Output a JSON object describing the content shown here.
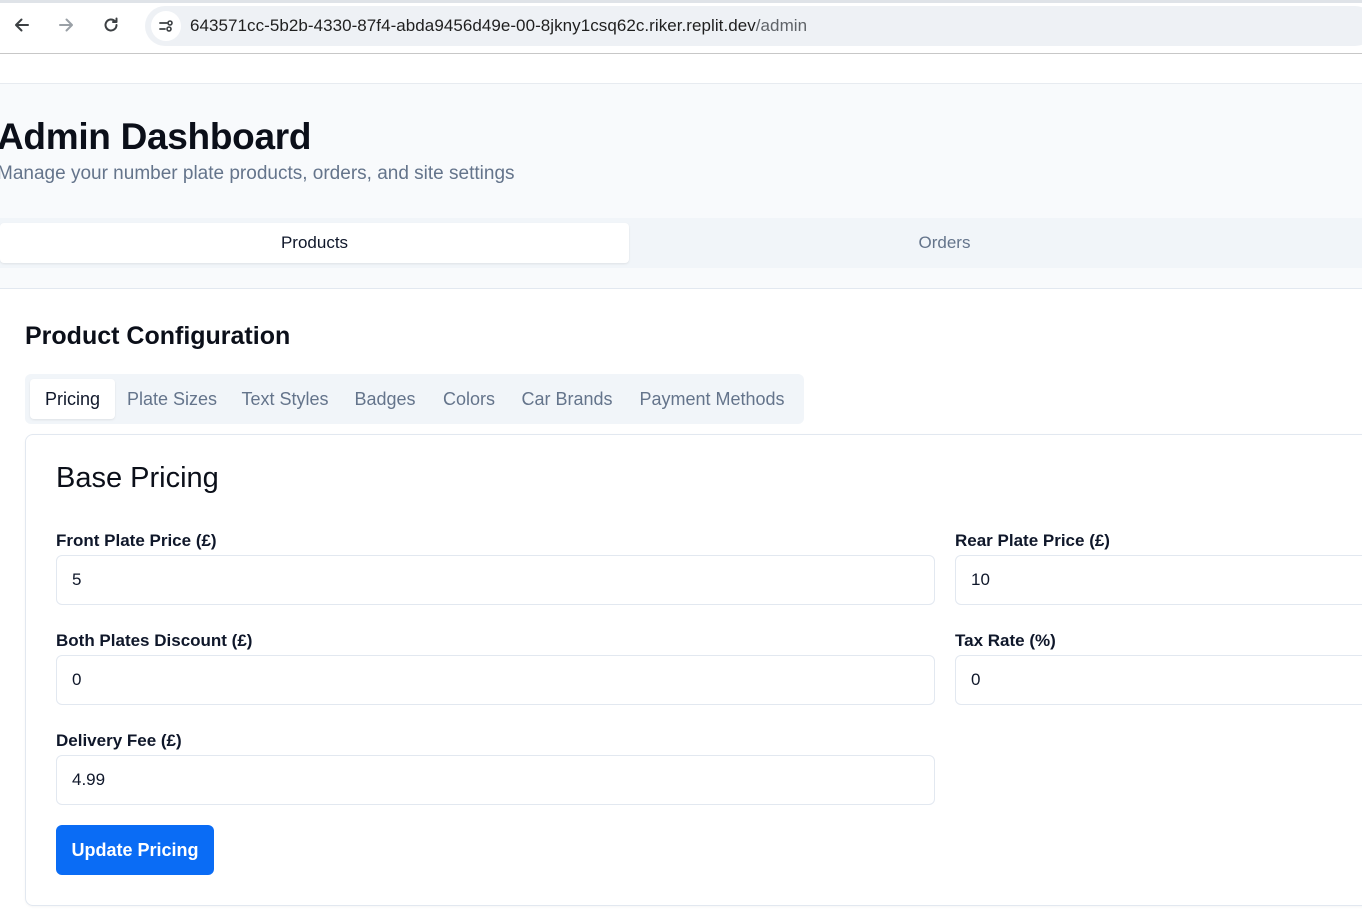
{
  "browser": {
    "url_host": "643571cc-5b2b-4330-87f4-abda9456d49e-00-8jkny1csq62c.riker.replit.dev",
    "url_path": "/admin"
  },
  "page": {
    "title": "Admin Dashboard",
    "subtitle": "Manage your number plate products, orders, and site settings"
  },
  "main_tabs": [
    {
      "label": "Products",
      "active": true
    },
    {
      "label": "Orders",
      "active": false
    }
  ],
  "product_config": {
    "title": "Product Configuration",
    "sub_tabs": [
      {
        "label": "Pricing",
        "active": true
      },
      {
        "label": "Plate Sizes",
        "active": false
      },
      {
        "label": "Text Styles",
        "active": false
      },
      {
        "label": "Badges",
        "active": false
      },
      {
        "label": "Colors",
        "active": false
      },
      {
        "label": "Car Brands",
        "active": false
      },
      {
        "label": "Payment Methods",
        "active": false
      }
    ]
  },
  "pricing_card": {
    "title": "Base Pricing",
    "fields": {
      "front_plate": {
        "label": "Front Plate Price (£)",
        "value": "5"
      },
      "rear_plate": {
        "label": "Rear Plate Price (£)",
        "value": "10"
      },
      "both_discount": {
        "label": "Both Plates Discount (£)",
        "value": "0"
      },
      "tax_rate": {
        "label": "Tax Rate (%)",
        "value": "0"
      },
      "delivery_fee": {
        "label": "Delivery Fee (£)",
        "value": "4.99"
      }
    },
    "submit_label": "Update Pricing"
  },
  "colors": {
    "primary": "#0a6cf5",
    "muted_text": "#64748b",
    "tab_background": "#f1f5f9"
  }
}
